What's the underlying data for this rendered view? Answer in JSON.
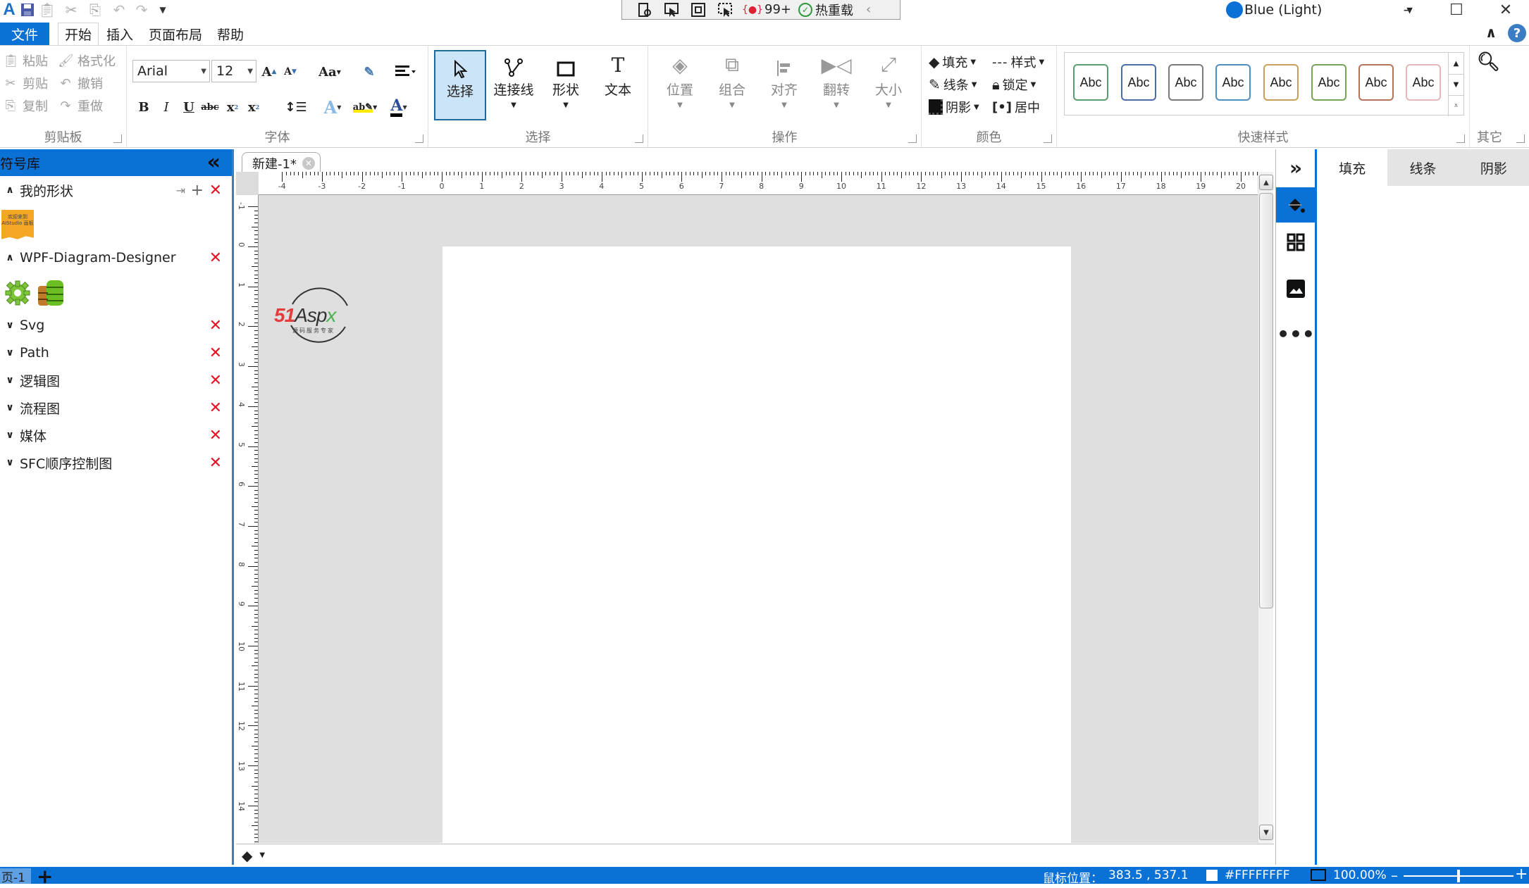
{
  "titlebar": {
    "quick_access": [
      "app-logo",
      "save",
      "paste",
      "cut",
      "copy",
      "undo",
      "redo",
      "customize"
    ],
    "devtools": {
      "error_count": "99+",
      "hot_reload": "热重载"
    },
    "theme": "Blue (Light)"
  },
  "menu": {
    "tabs": [
      {
        "label": "文件",
        "active": false
      },
      {
        "label": "开始",
        "active": true
      },
      {
        "label": "插入",
        "active": false
      },
      {
        "label": "页面布局",
        "active": false
      },
      {
        "label": "帮助",
        "active": false
      }
    ]
  },
  "ribbon": {
    "clipboard": {
      "label": "剪贴板",
      "items": [
        "粘贴",
        "剪贴",
        "复制",
        "格式化",
        "撤销",
        "重做"
      ]
    },
    "font": {
      "label": "字体",
      "family": "Arial",
      "size": "12",
      "aa_label": "Aa"
    },
    "select": {
      "label": "选择",
      "buttons": [
        "选择",
        "连接线",
        "形状",
        "文本"
      ]
    },
    "operate": {
      "label": "操作",
      "buttons": [
        "位置",
        "组合",
        "对齐",
        "翻转",
        "大小"
      ]
    },
    "color": {
      "label": "颜色",
      "fill": "填充",
      "line": "线条",
      "shadow": "阴影",
      "style": "样式",
      "lock": "锁定",
      "center": "居中"
    },
    "quickstyle": {
      "label": "快速样式",
      "sample_text": "Abc",
      "colors": [
        "#5b9e6e",
        "#4a6fa5",
        "#7a7a7a",
        "#4e8fbf",
        "#c9a05a",
        "#76a35a",
        "#b5735a",
        "#e8b8b8"
      ]
    },
    "other": {
      "label": "其它"
    }
  },
  "sidebar": {
    "title": "符号库",
    "sections": [
      {
        "label": "我的形状",
        "expanded": true
      },
      {
        "label": "WPF-Diagram-Designer",
        "expanded": true
      },
      {
        "label": "Svg",
        "expanded": false
      },
      {
        "label": "Path",
        "expanded": false
      },
      {
        "label": "逻辑图",
        "expanded": false
      },
      {
        "label": "流程图",
        "expanded": false
      },
      {
        "label": "媒体",
        "expanded": false
      },
      {
        "label": "SFC顺序控制图",
        "expanded": false
      }
    ],
    "my_shape_thumb": "欢迎来到 AIStudio 画板"
  },
  "document": {
    "tab_label": "新建-1*",
    "hruler_labels": [
      "-4",
      "-3",
      "-2",
      "-1",
      "0",
      "1",
      "2",
      "3",
      "4",
      "5",
      "6",
      "7",
      "8",
      "9",
      "10",
      "11",
      "12",
      "13",
      "14",
      "15",
      "16",
      "17",
      "18",
      "19",
      "20"
    ],
    "vruler_labels": [
      "-1",
      "0",
      "1",
      "2",
      "3",
      "4",
      "5",
      "6",
      "7",
      "8",
      "9",
      "10",
      "11",
      "12",
      "13",
      "14"
    ],
    "watermark": {
      "brand_red": "51",
      "brand_dark": "Asp",
      "brand_green": "x",
      "subtitle": "源码服务专家"
    }
  },
  "rightpanel": {
    "tabs": [
      {
        "label": "填充",
        "active": true
      },
      {
        "label": "线条",
        "active": false
      },
      {
        "label": "阴影",
        "active": false
      }
    ]
  },
  "status": {
    "page_tab": "页-1",
    "mouse_label": "鼠标位置：",
    "mouse_value": "383.5 , 537.1",
    "color_value": "#FFFFFFFF",
    "zoom": "100.00%",
    "zoom_fraction": 0.5
  }
}
